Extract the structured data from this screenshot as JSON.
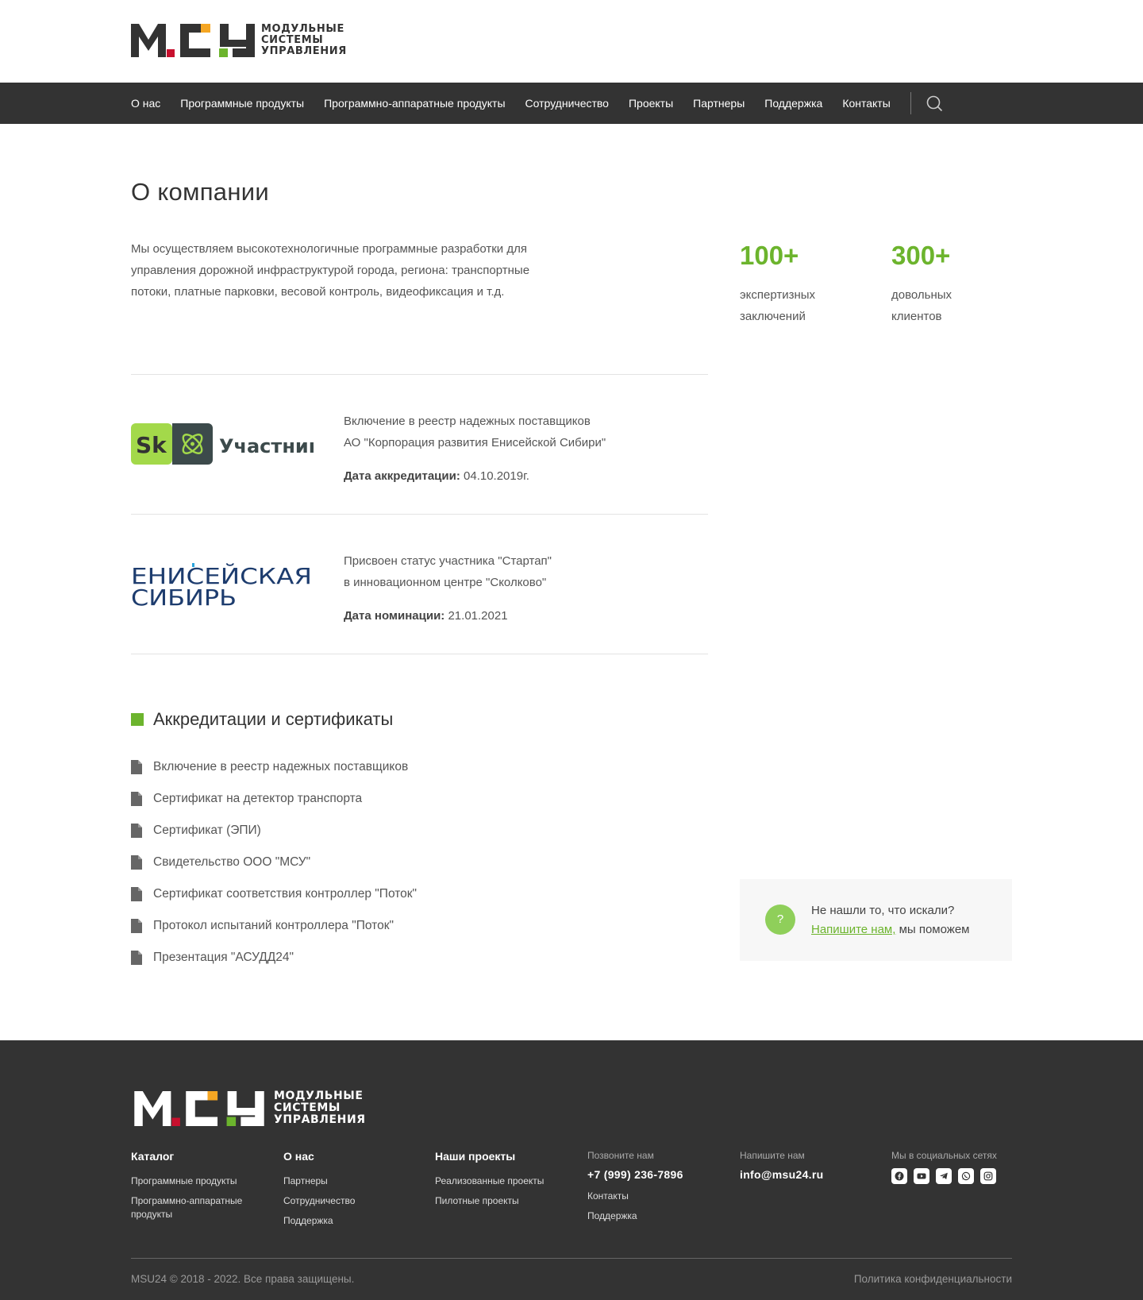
{
  "brand": {
    "logo_lines": [
      "МОДУЛЬНЫЕ",
      "СИСТЕМЫ",
      "УПРАВЛЕНИЯ"
    ],
    "colors": {
      "accent": "#6cb42d",
      "dark": "#333333",
      "red": "#c8102e",
      "orange": "#f5a623"
    }
  },
  "nav": {
    "items": [
      "О нас",
      "Программные продукты",
      "Программно-аппаратные продукты",
      "Сотрудничество",
      "Проекты",
      "Партнеры",
      "Поддержка",
      "Контакты"
    ],
    "search_icon": "search-icon"
  },
  "page": {
    "title": "О компании",
    "intro": "Мы осуществляем высокотехнологичные программные разработки для управления дорожной инфраструктурой города, региона: транспортные потоки, платные парковки, весовой контроль, видеофиксация и т.д."
  },
  "stats": [
    {
      "value": "100+",
      "label_line1": "экспертизных",
      "label_line2": "заключений"
    },
    {
      "value": "300+",
      "label_line1": "довольных",
      "label_line2": "клиентов"
    }
  ],
  "accreditations": [
    {
      "logo_sk": "Sk",
      "logo_text": "Участник",
      "line1": "Включение в реестр надежных поставщиков",
      "line2": "АО \"Корпорация развития Енисейской Сибири\"",
      "date_label": "Дата аккредитации:",
      "date_value": "04.10.2019г."
    },
    {
      "logo_line1": "ЕНИСЕЙСКАЯ",
      "logo_line2": "СИБИРЬ",
      "line1": "Присвоен статус участника \"Стартап\"",
      "line2": "в инновационном центре \"Сколково\"",
      "date_label": "Дата номинации:",
      "date_value": "21.01.2021"
    }
  ],
  "certificates": {
    "title": "Аккредитации и сертификаты",
    "items": [
      "Включение в реестр надежных поставщиков",
      "Сертификат на детектор транспорта",
      "Сертификат (ЭПИ)",
      "Свидетельство ООО \"МСУ\"",
      "Сертификат соответствия контроллер \"Поток\"",
      "Протокол испытаний контроллера \"Поток\"",
      "Презентация \"АСУДД24\""
    ]
  },
  "help": {
    "icon": "?",
    "line1": "Не нашли то, что искали?",
    "link": "Напишите нам,",
    "rest": " мы поможем"
  },
  "footer": {
    "catalog": {
      "title": "Каталог",
      "links": [
        "Программные продукты",
        "Программно-аппаратные продукты"
      ]
    },
    "about": {
      "title": "О нас",
      "links": [
        "Партнеры",
        "Сотрудничество",
        "Поддержка"
      ]
    },
    "projects": {
      "title": "Наши проекты",
      "links": [
        "Реализованные проекты",
        "Пилотные проекты"
      ]
    },
    "call": {
      "label": "Позвоните нам",
      "phone": "+7 (999) 236-7896",
      "links": [
        "Контакты",
        "Поддержка"
      ]
    },
    "write": {
      "label": "Напишите нам",
      "email": "info@msu24.ru"
    },
    "social": {
      "label": "Мы в социальных сетях",
      "icons": [
        "facebook-icon",
        "youtube-icon",
        "telegram-icon",
        "whatsapp-icon",
        "instagram-icon"
      ]
    },
    "copyright": "MSU24 © 2018 - 2022. Все права защищены.",
    "policy": "Политика конфиденциальности"
  }
}
